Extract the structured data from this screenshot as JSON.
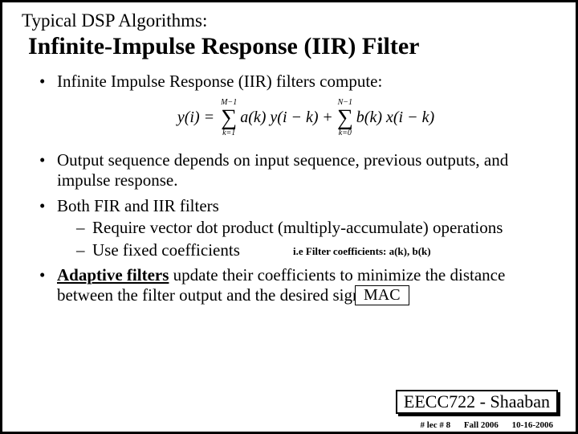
{
  "subtitle": "Typical DSP Algorithms:",
  "title": "Infinite-Impulse Response (IIR) Filter",
  "bullets": {
    "b1": "Infinite Impulse Response (IIR) filters compute:",
    "b2": "Output sequence depends on input sequence, previous outputs, and impulse response.",
    "b3": "Both FIR and IIR filters",
    "b3a": "Require vector dot product (multiply-accumulate) operations",
    "b3b": "Use fixed coefficients",
    "b4a": "Adaptive filters",
    "b4b": " update their coefficients to minimize the distance between the filter output and the desired signal."
  },
  "formula": {
    "lhs": "y(i) =",
    "sum1_top": "M−1",
    "sum1_bot": "k=1",
    "term1": "a(k) y(i − k)",
    "plus": "+",
    "sum2_top": "N−1",
    "sum2_bot": "k=0",
    "term2": "b(k) x(i − k)"
  },
  "note_coeff": "i.e Filter coefficients:  a(k), b(k)",
  "mac": "MAC",
  "course": "EECC722 - Shaaban",
  "footer": {
    "lec": "#  lec # 8",
    "term": "Fall 2006",
    "date": "10-16-2006"
  }
}
